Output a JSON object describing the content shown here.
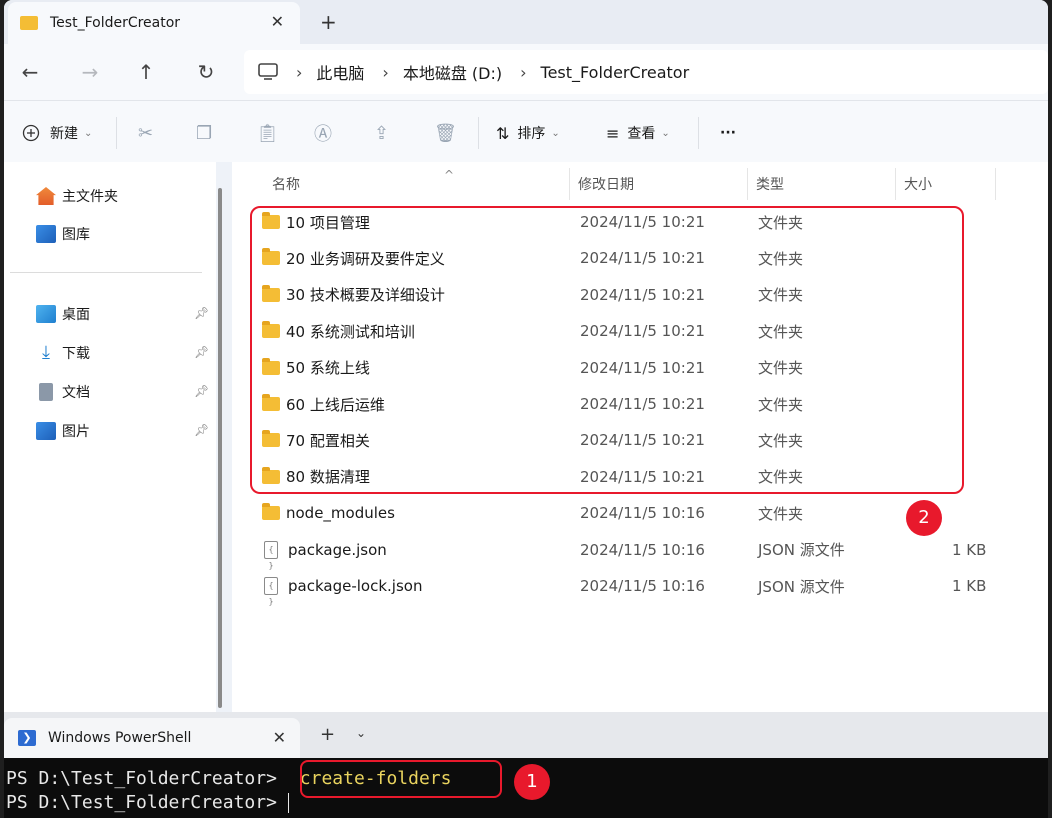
{
  "explorer": {
    "tab_title": "Test_FolderCreator",
    "close_glyph": "✕",
    "new_tab_glyph": "+",
    "breadcrumb": [
      "此电脑",
      "本地磁盘 (D:)",
      "Test_FolderCreator"
    ],
    "toolbar": {
      "new_label": "新建",
      "sort_label": "排序",
      "view_label": "查看",
      "more_label": "···"
    },
    "sidebar": {
      "pinned": [
        {
          "label": "主文件夹",
          "icon": "home-icon"
        },
        {
          "label": "图库",
          "icon": "gallery-icon"
        }
      ],
      "quick": [
        {
          "label": "桌面",
          "icon": "desktop-icon"
        },
        {
          "label": "下载",
          "icon": "download-icon"
        },
        {
          "label": "文档",
          "icon": "document-icon"
        },
        {
          "label": "图片",
          "icon": "pictures-icon"
        }
      ]
    },
    "columns": [
      "名称",
      "修改日期",
      "类型",
      "大小"
    ],
    "files": [
      {
        "name": "10 项目管理",
        "date": "2024/11/5 10:21",
        "type": "文件夹",
        "size": "",
        "kind": "folder"
      },
      {
        "name": "20 业务调研及要件定义",
        "date": "2024/11/5 10:21",
        "type": "文件夹",
        "size": "",
        "kind": "folder"
      },
      {
        "name": "30 技术概要及详细设计",
        "date": "2024/11/5 10:21",
        "type": "文件夹",
        "size": "",
        "kind": "folder"
      },
      {
        "name": "40 系统测试和培训",
        "date": "2024/11/5 10:21",
        "type": "文件夹",
        "size": "",
        "kind": "folder"
      },
      {
        "name": "50 系统上线",
        "date": "2024/11/5 10:21",
        "type": "文件夹",
        "size": "",
        "kind": "folder"
      },
      {
        "name": "60 上线后运维",
        "date": "2024/11/5 10:21",
        "type": "文件夹",
        "size": "",
        "kind": "folder"
      },
      {
        "name": "70 配置相关",
        "date": "2024/11/5 10:21",
        "type": "文件夹",
        "size": "",
        "kind": "folder"
      },
      {
        "name": "80 数据清理",
        "date": "2024/11/5 10:21",
        "type": "文件夹",
        "size": "",
        "kind": "folder"
      },
      {
        "name": "node_modules",
        "date": "2024/11/5 10:16",
        "type": "文件夹",
        "size": "",
        "kind": "folder"
      },
      {
        "name": "package.json",
        "date": "2024/11/5 10:16",
        "type": "JSON 源文件",
        "size": "1 KB",
        "kind": "file"
      },
      {
        "name": "package-lock.json",
        "date": "2024/11/5 10:16",
        "type": "JSON 源文件",
        "size": "1 KB",
        "kind": "file"
      }
    ],
    "badge_2": "2"
  },
  "powershell": {
    "tab_title": "Windows PowerShell",
    "prompt1": "PS D:\\Test_FolderCreator> ",
    "command": "create-folders",
    "prompt2": "PS D:\\Test_FolderCreator> ",
    "badge_1": "1"
  },
  "colors": {
    "highlight": "#e8192c",
    "folder": "#f4bd35",
    "ps_command": "#e9d35e"
  }
}
